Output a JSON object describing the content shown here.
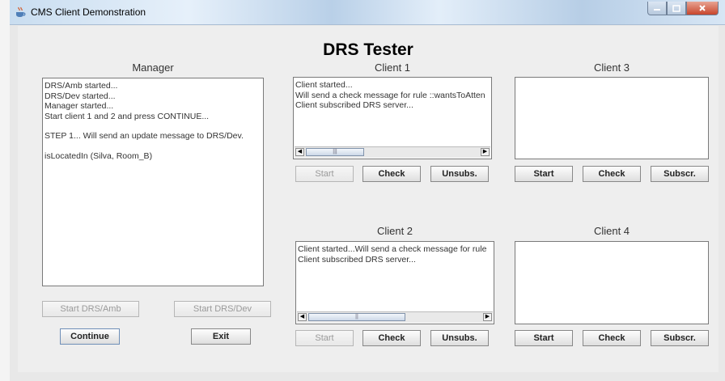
{
  "window": {
    "title": "CMS Client Demonstration"
  },
  "heading": "DRS Tester",
  "manager": {
    "label": "Manager",
    "log": [
      "DRS/Amb started...",
      "DRS/Dev started...",
      "Manager started...",
      "Start client 1 and 2 and press CONTINUE...",
      "STEP 1... Will send an update message to DRS/Dev.",
      "isLocatedIn (Silva, Room_B)"
    ],
    "buttons": {
      "start_amb": "Start DRS/Amb",
      "start_dev": "Start DRS/Dev",
      "continue": "Continue",
      "exit": "Exit"
    }
  },
  "client1": {
    "label": "Client 1",
    "log": [
      "Client started...",
      "Will send a check message for rule ::wantsToAtten",
      "Client subscribed DRS server..."
    ],
    "buttons": {
      "start": "Start",
      "check": "Check",
      "action": "Unsubs."
    }
  },
  "client2": {
    "label": "Client 2",
    "log": [
      "Client started...Will send a check message for rule",
      "Client subscribed DRS server..."
    ],
    "buttons": {
      "start": "Start",
      "check": "Check",
      "action": "Unsubs."
    }
  },
  "client3": {
    "label": "Client 3",
    "buttons": {
      "start": "Start",
      "check": "Check",
      "action": "Subscr."
    }
  },
  "client4": {
    "label": "Client 4",
    "buttons": {
      "start": "Start",
      "check": "Check",
      "action": "Subscr."
    }
  },
  "icons": {
    "app": "java-cup-icon",
    "minimize": "minimize-icon",
    "maximize": "maximize-icon",
    "close": "close-icon",
    "scroll_left": "arrow-left-icon",
    "scroll_right": "arrow-right-icon"
  }
}
